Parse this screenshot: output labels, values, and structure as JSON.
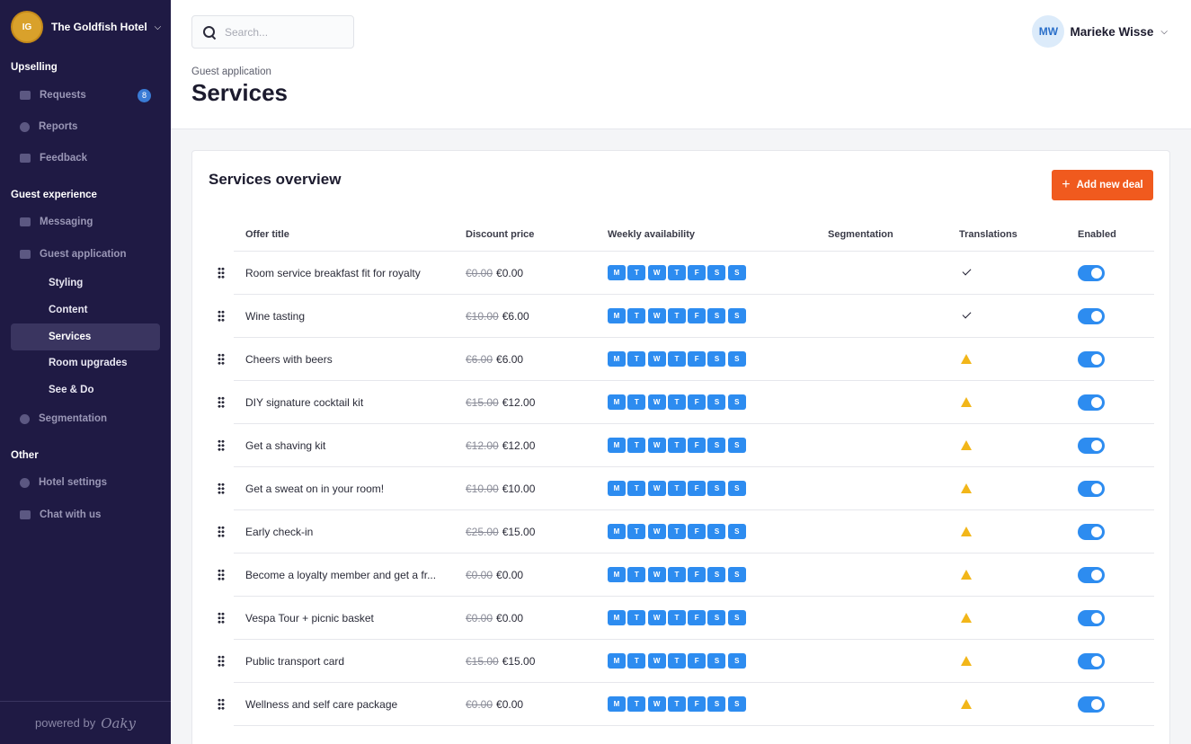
{
  "hotel": {
    "name": "The Goldfish Hotel",
    "logo_text": "IG"
  },
  "sidebar": {
    "sections": [
      {
        "title": "Upselling"
      },
      {
        "title": "Guest experience"
      },
      {
        "title": "Other"
      }
    ],
    "upselling": [
      {
        "label": "Requests",
        "icon": "requests-icon",
        "badge": "8"
      },
      {
        "label": "Reports",
        "icon": "reports-icon"
      },
      {
        "label": "Feedback",
        "icon": "feedback-icon"
      }
    ],
    "guest_experience": [
      {
        "label": "Messaging",
        "icon": "messaging-icon"
      },
      {
        "label": "Guest application",
        "icon": "guest-application-icon"
      }
    ],
    "guest_app_sub": [
      "Styling",
      "Content",
      "Services",
      "Room upgrades",
      "See & Do"
    ],
    "segmentation": {
      "label": "Segmentation",
      "icon": "segmentation-icon"
    },
    "other": [
      {
        "label": "Hotel settings",
        "icon": "settings-icon"
      },
      {
        "label": "Chat with us",
        "icon": "chat-icon"
      }
    ],
    "footer": {
      "powered": "powered by",
      "brand": "Oaky"
    }
  },
  "search": {
    "placeholder": "Search..."
  },
  "user": {
    "initials": "MW",
    "name": "Marieke Wisse"
  },
  "header": {
    "breadcrumb": "Guest application",
    "title": "Services"
  },
  "card": {
    "title": "Services overview",
    "add_button": "Add new deal",
    "columns": [
      "Offer title",
      "Discount price",
      "Weekly availability",
      "Segmentation",
      "Translations",
      "Enabled"
    ],
    "days": [
      "M",
      "T",
      "W",
      "T",
      "F",
      "S",
      "S"
    ],
    "rows": [
      {
        "title": "Room service breakfast fit for royalty",
        "old": "€0.00",
        "price": "€0.00",
        "translations": "check",
        "enabled": true
      },
      {
        "title": "Wine tasting",
        "old": "€10.00",
        "price": "€6.00",
        "translations": "check",
        "enabled": true
      },
      {
        "title": "Cheers with beers",
        "old": "€6.00",
        "price": "€6.00",
        "translations": "warning",
        "enabled": true
      },
      {
        "title": "DIY signature cocktail kit",
        "old": "€15.00",
        "price": "€12.00",
        "translations": "warning",
        "enabled": true
      },
      {
        "title": "Get a shaving kit",
        "old": "€12.00",
        "price": "€12.00",
        "translations": "warning",
        "enabled": true
      },
      {
        "title": "Get a sweat on in your room!",
        "old": "€10.00",
        "price": "€10.00",
        "translations": "warning",
        "enabled": true
      },
      {
        "title": "Early check-in",
        "old": "€25.00",
        "price": "€15.00",
        "translations": "warning",
        "enabled": true
      },
      {
        "title": "Become a loyalty member and get a fr...",
        "old": "€0.00",
        "price": "€0.00",
        "translations": "warning",
        "enabled": true
      },
      {
        "title": "Vespa Tour + picnic basket",
        "old": "€0.00",
        "price": "€0.00",
        "translations": "warning",
        "enabled": true
      },
      {
        "title": "Public transport card",
        "old": "€15.00",
        "price": "€15.00",
        "translations": "warning",
        "enabled": true
      },
      {
        "title": "Wellness and self care package",
        "old": "€0.00",
        "price": "€0.00",
        "translations": "warning",
        "enabled": true
      }
    ]
  },
  "colors": {
    "sidebar": "#1f1a44",
    "accent": "#f05a1e",
    "day_chip": "#2d8cf0",
    "warning": "#f2b619"
  }
}
